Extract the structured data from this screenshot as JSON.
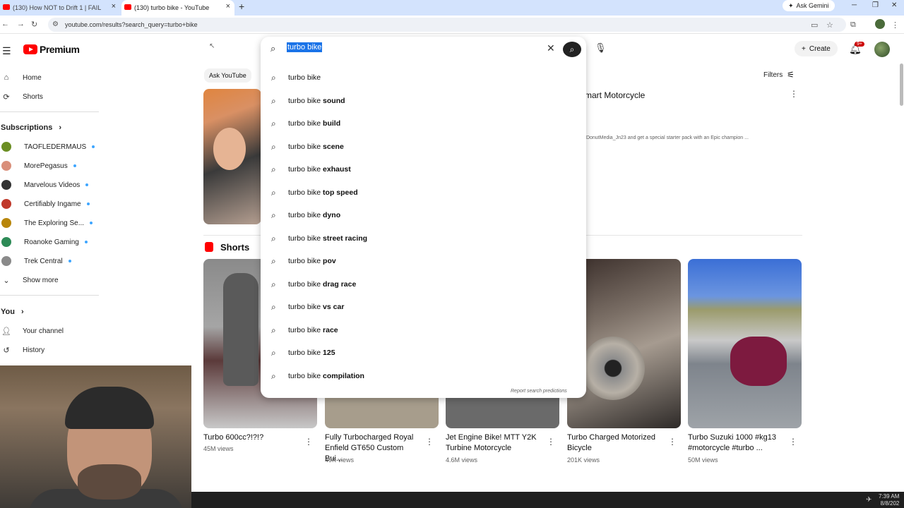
{
  "browser": {
    "tabs": [
      {
        "title": "(130) How NOT to Drift 1 | FAIL"
      },
      {
        "title": "(130) turbo bike - YouTube"
      }
    ],
    "new_tab": "+",
    "gemini_label": "Ask Gemini",
    "url": "youtube.com/results?search_query=turbo+bike"
  },
  "header": {
    "logo_text": "Premium",
    "create_label": "Create",
    "notification_badge": "9+"
  },
  "search": {
    "query": "turbo bike",
    "suggestions": [
      {
        "prefix": "turbo bike",
        "rest": ""
      },
      {
        "prefix": "turbo bike",
        "rest": " sound"
      },
      {
        "prefix": "turbo bike",
        "rest": " build"
      },
      {
        "prefix": "turbo bike",
        "rest": " scene"
      },
      {
        "prefix": "turbo bike",
        "rest": " exhaust"
      },
      {
        "prefix": "turbo bike",
        "rest": " top speed"
      },
      {
        "prefix": "turbo bike",
        "rest": " dyno"
      },
      {
        "prefix": "turbo bike",
        "rest": " street racing"
      },
      {
        "prefix": "turbo bike",
        "rest": " pov"
      },
      {
        "prefix": "turbo bike",
        "rest": " drag race"
      },
      {
        "prefix": "turbo bike",
        "rest": " vs car"
      },
      {
        "prefix": "turbo bike",
        "rest": " race"
      },
      {
        "prefix": "turbo bike",
        "rest": " 125"
      },
      {
        "prefix": "turbo bike",
        "rest": " compilation"
      }
    ],
    "report_label": "Report search predictions"
  },
  "sidebar": {
    "home": "Home",
    "shorts": "Shorts",
    "subscriptions_heading": "Subscriptions",
    "channels": [
      {
        "name": "TAOFLEDERMAUS",
        "color": "#6b8e23"
      },
      {
        "name": "MorePegasus",
        "color": "#d98f7a"
      },
      {
        "name": "Marvelous Videos",
        "color": "#333333"
      },
      {
        "name": "Certifiably Ingame",
        "color": "#c0392b"
      },
      {
        "name": "The Exploring Se...",
        "color": "#b8860b"
      },
      {
        "name": "Roanoke Gaming",
        "color": "#2e8b57"
      },
      {
        "name": "Trek Central",
        "color": "#8a8a8a"
      }
    ],
    "show_more": "Show more",
    "you_heading": "You",
    "your_channel": "Your channel",
    "history": "History"
  },
  "main": {
    "ask_chip": "Ask YouTube",
    "filters": "Filters",
    "video_title_partial": "mart Motorcycle",
    "video_desc_partial": "/DonutMedia_Jn23 and get a special starter pack with an Epic champion ...",
    "shorts_heading": "Shorts",
    "shorts": [
      {
        "title": "Turbo 600cc?!?!?",
        "title2": "",
        "views": "45M views"
      },
      {
        "title": "Fully Turbocharged Royal",
        "title2": "Enfield GT650 Custom Bui...",
        "views": "49K views"
      },
      {
        "title": "Jet Engine Bike! MTT Y2K",
        "title2": "Turbine Motorcycle",
        "views": "4.6M views"
      },
      {
        "title": "Turbo Charged Motorized",
        "title2": "Bicycle",
        "views": "201K views"
      },
      {
        "title": "Turbo Suzuki 1000 #kg13",
        "title2": "#motorcycle #turbo ...",
        "views": "50M views"
      }
    ]
  },
  "taskbar": {
    "time": "7:39 AM",
    "date": "8/8/202"
  }
}
